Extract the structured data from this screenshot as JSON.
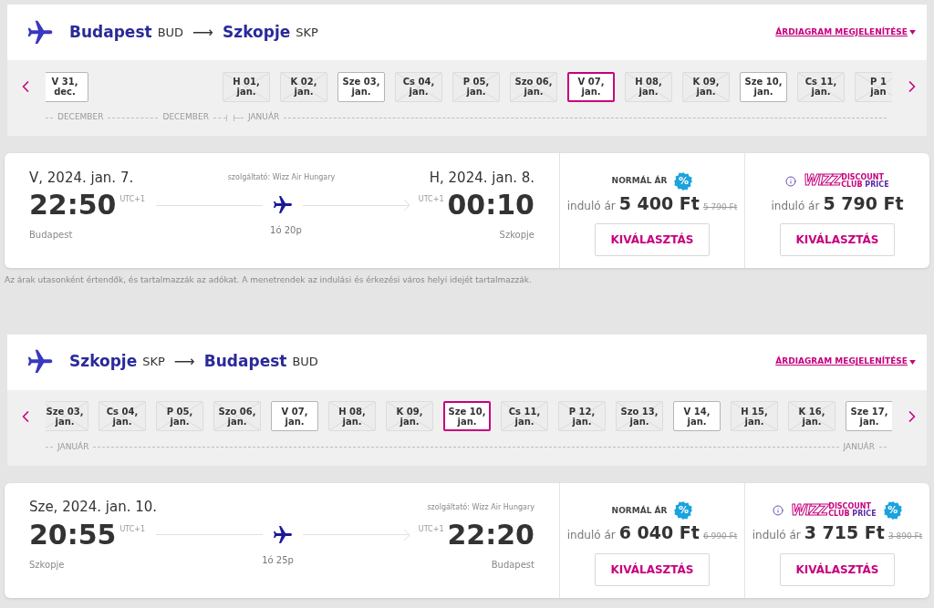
{
  "journeys": [
    {
      "origin": {
        "city": "Budapest",
        "code": "BUD"
      },
      "destination": {
        "city": "Szkopje",
        "code": "SKP"
      },
      "arrow": "⟶",
      "chart_link": "ÁRDIAGRAM MEGJELENÍTÉSE",
      "dates": [
        {
          "kind": "available",
          "day": "V 31,",
          "month": "dec.",
          "selected": false
        },
        {
          "kind": "blank"
        },
        {
          "kind": "blank"
        },
        {
          "kind": "unavailable",
          "day": "H 01,",
          "month": "jan.",
          "selected": false
        },
        {
          "kind": "unavailable",
          "day": "K 02,",
          "month": "jan.",
          "selected": false
        },
        {
          "kind": "available",
          "day": "Sze 03,",
          "month": "jan.",
          "selected": false
        },
        {
          "kind": "unavailable",
          "day": "Cs 04,",
          "month": "jan.",
          "selected": false
        },
        {
          "kind": "unavailable",
          "day": "P 05,",
          "month": "jan.",
          "selected": false
        },
        {
          "kind": "unavailable",
          "day": "Szo 06,",
          "month": "jan.",
          "selected": false
        },
        {
          "kind": "available",
          "day": "V 07,",
          "month": "jan.",
          "selected": true
        },
        {
          "kind": "unavailable",
          "day": "H 08,",
          "month": "jan.",
          "selected": false
        },
        {
          "kind": "unavailable",
          "day": "K 09,",
          "month": "jan.",
          "selected": false
        },
        {
          "kind": "available",
          "day": "Sze 10,",
          "month": "jan.",
          "selected": false
        },
        {
          "kind": "unavailable",
          "day": "Cs 11,",
          "month": "jan.",
          "selected": false
        },
        {
          "kind": "unavailable",
          "day": "P 1",
          "month": "jan",
          "selected": false
        }
      ],
      "timeline": [
        {
          "label": "DECEMBER",
          "kind": "leading",
          "year_break": false
        },
        {
          "label": "DECEMBER",
          "kind": "leading",
          "year_break": true
        },
        {
          "label": "JANUÁR",
          "kind": "leading",
          "year_break": false
        }
      ],
      "flight": {
        "departure_date": "V, 2024. jan. 7.",
        "arrival_date": "H, 2024. jan. 8.",
        "carrier": "szolgáltató: Wizz Air Hungary",
        "departure_time": "22:50",
        "arrival_time": "00:10",
        "departure_zone": "UTC+1",
        "arrival_zone": "UTC+1",
        "from": "Budapest",
        "to": "Szkopje",
        "duration": "1ó 20p"
      },
      "fares": [
        {
          "kind": "normal",
          "label": "NORMÁL ÁR",
          "badge": "%",
          "prefix": "induló ár",
          "price": "5 400 Ft",
          "old_price": "5 790 Ft",
          "button": "KIVÁLASZTÁS"
        },
        {
          "kind": "club",
          "logo": {
            "mark": "WIZZ",
            "top": "DISCOUNT",
            "bottom_left": "CLUB",
            "bottom_right": "PRICE"
          },
          "prefix": "induló ár",
          "price": "5 790 Ft",
          "button": "KIVÁLASZTÁS"
        }
      ],
      "note": "Az árak utasonként értendők, és tartalmazzák az adókat. A menetrendek az indulási és érkezési város helyi idejét tartalmazzák."
    },
    {
      "origin": {
        "city": "Szkopje",
        "code": "SKP"
      },
      "destination": {
        "city": "Budapest",
        "code": "BUD"
      },
      "arrow": "⟶",
      "chart_link": "ÁRDIAGRAM MEGJELENÍTÉSE",
      "dates": [
        {
          "kind": "unavailable",
          "day": "Sze 03,",
          "month": "jan.",
          "selected": false
        },
        {
          "kind": "unavailable",
          "day": "Cs 04,",
          "month": "jan.",
          "selected": false
        },
        {
          "kind": "unavailable",
          "day": "P 05,",
          "month": "jan.",
          "selected": false
        },
        {
          "kind": "unavailable",
          "day": "Szo 06,",
          "month": "jan.",
          "selected": false
        },
        {
          "kind": "available",
          "day": "V 07,",
          "month": "jan.",
          "selected": false
        },
        {
          "kind": "unavailable",
          "day": "H 08,",
          "month": "jan.",
          "selected": false
        },
        {
          "kind": "unavailable",
          "day": "K 09,",
          "month": "jan.",
          "selected": false
        },
        {
          "kind": "available",
          "day": "Sze 10,",
          "month": "jan.",
          "selected": true
        },
        {
          "kind": "unavailable",
          "day": "Cs 11,",
          "month": "jan.",
          "selected": false
        },
        {
          "kind": "unavailable",
          "day": "P 12,",
          "month": "jan.",
          "selected": false
        },
        {
          "kind": "unavailable",
          "day": "Szo 13,",
          "month": "jan.",
          "selected": false
        },
        {
          "kind": "available",
          "day": "V 14,",
          "month": "jan.",
          "selected": false
        },
        {
          "kind": "unavailable",
          "day": "H 15,",
          "month": "jan.",
          "selected": false
        },
        {
          "kind": "unavailable",
          "day": "K 16,",
          "month": "jan.",
          "selected": false
        },
        {
          "kind": "available",
          "day": "Sze 17,",
          "month": "jan.",
          "selected": false
        }
      ],
      "timeline": [
        {
          "label": "JANUÁR",
          "kind": "leading",
          "year_break": false
        },
        {
          "label": "JANUÁR",
          "kind": "trailing",
          "year_break": false
        }
      ],
      "flight": {
        "departure_date": "Sze, 2024. jan. 10.",
        "carrier": "szolgáltató: Wizz Air Hungary",
        "departure_time": "20:55",
        "arrival_time": "22:20",
        "departure_zone": "UTC+1",
        "arrival_zone": "UTC+1",
        "from": "Szkopje",
        "to": "Budapest",
        "duration": "1ó 25p"
      },
      "fares": [
        {
          "kind": "normal",
          "label": "NORMÁL ÁR",
          "badge": "%",
          "prefix": "induló ár",
          "price": "6 040 Ft",
          "old_price": "6 990 Ft",
          "button": "KIVÁLASZTÁS"
        },
        {
          "kind": "club",
          "logo": {
            "mark": "WIZZ",
            "top": "DISCOUNT",
            "bottom_left": "CLUB",
            "bottom_right": "PRICE"
          },
          "badge": "%",
          "prefix": "induló ár",
          "price": "3 715 Ft",
          "old_price": "3 890 Ft",
          "button": "KIVÁLASZTÁS"
        }
      ]
    }
  ]
}
